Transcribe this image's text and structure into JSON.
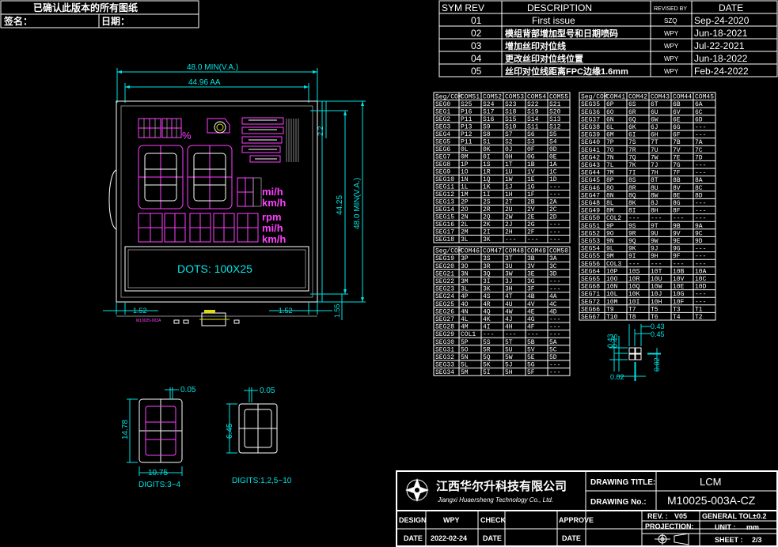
{
  "signoff": {
    "title": "已确认此版本的所有图纸",
    "sign_label": "签名：",
    "date_label": "日期："
  },
  "revisions": {
    "headers": [
      "SYM REV",
      "DESCRIPTION",
      "REVISED BY",
      "DATE"
    ],
    "rows": [
      {
        "rev": "01",
        "desc": "First issue",
        "by": "SZQ",
        "date": "Sep-24-2020"
      },
      {
        "rev": "02",
        "desc": "模组背部增加型号和日期喷码",
        "by": "WPY",
        "date": "Jun-18-2021"
      },
      {
        "rev": "03",
        "desc": "增加丝印对位线",
        "by": "WPY",
        "date": "Jul-22-2021"
      },
      {
        "rev": "04",
        "desc": "更改丝印对位线位置",
        "by": "WPY",
        "date": "Jun-18-2022"
      },
      {
        "rev": "05",
        "desc": "丝印对位线距离FPC边缘1.6mm",
        "by": "WPY",
        "date": "Feb-24-2022"
      }
    ]
  },
  "dimensions": {
    "width_va": "48.0 MIN(V.A.)",
    "width_aa": "44.96 AA",
    "height_aa": "44.25",
    "height_va": "48.0 MIN(V.A.)",
    "top_gap": "2.2",
    "left_margin": "1.52",
    "right_margin": "1.52",
    "bottom_margin": "1.55"
  },
  "display": {
    "dots_label": "DOTS: 100X25",
    "unit_mih_1": "mi/h",
    "unit_kmh_1": "km/h",
    "unit_rpm": "rpm",
    "unit_mih_2": "mi/h",
    "unit_kmh_2": "km/h",
    "percent": "%",
    "part_marking": "M10025-003A"
  },
  "pin_tables": {
    "table1": {
      "headers": [
        "Seg/COM",
        "COM51",
        "COM52",
        "COM53",
        "COM54",
        "COM55"
      ],
      "rows": [
        [
          "SEG0",
          "S25",
          "S24",
          "S23",
          "S22",
          "S21"
        ],
        [
          "SEG1",
          "P16",
          "S17",
          "S18",
          "S19",
          "S20"
        ],
        [
          "SEG2",
          "P11",
          "S16",
          "S15",
          "S14",
          "S13"
        ],
        [
          "SEG3",
          "P13",
          "S9",
          "S10",
          "S11",
          "S12"
        ],
        [
          "SEG4",
          "P12",
          "S8",
          "S7",
          "S6",
          "S5"
        ],
        [
          "SEG5",
          "P11",
          "S1",
          "S2",
          "S3",
          "S4"
        ],
        [
          "SEG6",
          "0L",
          "0K",
          "0J",
          "0F",
          "0D"
        ],
        [
          "SEG7",
          "0M",
          "0I",
          "0H",
          "0G",
          "0E"
        ],
        [
          "SEG8",
          "1P",
          "1S",
          "1T",
          "1B",
          "1A"
        ],
        [
          "SEG9",
          "1O",
          "1R",
          "1U",
          "1V",
          "1C"
        ],
        [
          "SEG10",
          "1N",
          "1Q",
          "1W",
          "1E",
          "1D"
        ],
        [
          "SEG11",
          "1L",
          "1K",
          "1J",
          "1G",
          "---"
        ],
        [
          "SEG12",
          "1M",
          "1I",
          "1H",
          "1F",
          "---"
        ],
        [
          "SEG13",
          "2P",
          "2S",
          "2T",
          "2B",
          "2A"
        ],
        [
          "SEG14",
          "2O",
          "2R",
          "2U",
          "2V",
          "2C"
        ],
        [
          "SEG15",
          "2N",
          "2Q",
          "2W",
          "2E",
          "2D"
        ],
        [
          "SEG16",
          "2L",
          "2K",
          "2J",
          "2G",
          "---"
        ],
        [
          "SEG17",
          "2M",
          "2I",
          "2H",
          "2F",
          "---"
        ],
        [
          "SEG18",
          "3L",
          "3K",
          "---",
          "---",
          "---"
        ]
      ]
    },
    "table2": {
      "headers": [
        "Seg/COM",
        "COM41",
        "COM42",
        "COM43",
        "COM44",
        "COM45"
      ],
      "rows": [
        [
          "SEG35",
          "6P",
          "6S",
          "6T",
          "6B",
          "6A"
        ],
        [
          "SEG36",
          "6O",
          "6R",
          "6U",
          "6V",
          "6C"
        ],
        [
          "SEG37",
          "6N",
          "6Q",
          "6W",
          "6E",
          "6D"
        ],
        [
          "SEG38",
          "6L",
          "6K",
          "6J",
          "6G",
          "---"
        ],
        [
          "SEG39",
          "6M",
          "6I",
          "6H",
          "6F",
          "---"
        ],
        [
          "SEG40",
          "7P",
          "7S",
          "7T",
          "7B",
          "7A"
        ],
        [
          "SEG41",
          "7O",
          "7R",
          "7U",
          "7V",
          "7C"
        ],
        [
          "SEG42",
          "7N",
          "7Q",
          "7W",
          "7E",
          "7D"
        ],
        [
          "SEG43",
          "7L",
          "7K",
          "7J",
          "7G",
          "---"
        ],
        [
          "SEG44",
          "7M",
          "7I",
          "7H",
          "7F",
          "---"
        ],
        [
          "SEG45",
          "8P",
          "8S",
          "8T",
          "8B",
          "8A"
        ],
        [
          "SEG46",
          "8O",
          "8R",
          "8U",
          "8V",
          "8C"
        ],
        [
          "SEG47",
          "8N",
          "8Q",
          "8W",
          "8E",
          "8D"
        ],
        [
          "SEG48",
          "8L",
          "8K",
          "8J",
          "8G",
          "---"
        ],
        [
          "SEG49",
          "8M",
          "8I",
          "8H",
          "8F",
          "---"
        ],
        [
          "SEG50",
          "COL2",
          "---",
          "---",
          "---",
          "---"
        ],
        [
          "SEG51",
          "9P",
          "9S",
          "9T",
          "9B",
          "9A"
        ],
        [
          "SEG52",
          "9O",
          "9R",
          "9U",
          "9V",
          "9C"
        ],
        [
          "SEG53",
          "9N",
          "9Q",
          "9W",
          "9E",
          "9D"
        ],
        [
          "SEG54",
          "9L",
          "9K",
          "9J",
          "9G",
          "---"
        ],
        [
          "SEG55",
          "9M",
          "9I",
          "9H",
          "9F",
          "---"
        ],
        [
          "SEG56",
          "COL3",
          "---",
          "---",
          "---",
          "---"
        ],
        [
          "SEG64",
          "10P",
          "10S",
          "10T",
          "10B",
          "10A"
        ],
        [
          "SEG65",
          "10O",
          "10R",
          "10U",
          "10V",
          "10C"
        ],
        [
          "SEG68",
          "10N",
          "10Q",
          "10W",
          "10E",
          "10D"
        ],
        [
          "SEG71",
          "10L",
          "10K",
          "10J",
          "10G",
          "---"
        ],
        [
          "SEG72",
          "10M",
          "10I",
          "10H",
          "10F",
          "---"
        ],
        [
          "SEG66",
          "T9",
          "T7",
          "T5",
          "T3",
          "T1"
        ],
        [
          "SEG67",
          "T10",
          "T8",
          "T6",
          "T4",
          "T2"
        ]
      ]
    },
    "table3": {
      "headers": [
        "Seg/COM",
        "COM46",
        "COM47",
        "COM48",
        "COM49",
        "COM50"
      ],
      "rows": [
        [
          "SEG19",
          "3P",
          "3S",
          "3T",
          "3B",
          "3A"
        ],
        [
          "SEG20",
          "3O",
          "3R",
          "3U",
          "3V",
          "3C"
        ],
        [
          "SEG21",
          "3N",
          "3Q",
          "3W",
          "3E",
          "3D"
        ],
        [
          "SEG22",
          "3M",
          "3I",
          "3J",
          "3G",
          "---"
        ],
        [
          "SEG23",
          "3L",
          "3K",
          "3H",
          "3F",
          "---"
        ],
        [
          "SEG24",
          "4P",
          "4S",
          "4T",
          "4B",
          "4A"
        ],
        [
          "SEG25",
          "4O",
          "4R",
          "4U",
          "4V",
          "4C"
        ],
        [
          "SEG26",
          "4N",
          "4Q",
          "4W",
          "4E",
          "4D"
        ],
        [
          "SEG27",
          "4L",
          "4K",
          "4J",
          "4G",
          "---"
        ],
        [
          "SEG28",
          "4M",
          "4I",
          "4H",
          "4F",
          "---"
        ],
        [
          "SEG29",
          "COL1",
          "---",
          "---",
          "---",
          "---"
        ],
        [
          "SEG30",
          "5P",
          "5S",
          "5T",
          "5B",
          "5A"
        ],
        [
          "SEG31",
          "5O",
          "5R",
          "5U",
          "5V",
          "5C"
        ],
        [
          "SEG32",
          "5N",
          "5Q",
          "5W",
          "5E",
          "5D"
        ],
        [
          "SEG33",
          "5L",
          "5K",
          "5J",
          "5G",
          "---"
        ],
        [
          "SEG34",
          "5M",
          "5I",
          "5H",
          "5F",
          "---"
        ]
      ]
    }
  },
  "dot_detail": {
    "pitch_1": "0.43",
    "pitch_2": "0.45",
    "v_1": "0.43",
    "v_2": "0.45",
    "gap_h": "0.02",
    "gap_v": "0.02"
  },
  "digit_details": {
    "large": {
      "height": "14.78",
      "width": "10.75",
      "gap": "0.05",
      "caption": "DIGITS:3~4"
    },
    "small": {
      "height": "6.45",
      "gap": "0.05",
      "caption": "DIGITS:1,2,5~10"
    }
  },
  "title_block": {
    "company_cn": "江西华尔升科技有限公司",
    "company_en": "Jiangxi Huaersheng Technology Co., Ltd.",
    "drawing_title_label": "DRAWING TITLE:",
    "drawing_title": "LCM",
    "drawing_no_label": "DRAWING No.:",
    "drawing_no": "M10025-003A-CZ",
    "rev_label": "REV. :",
    "rev": "V05",
    "tol_label": "GENERAL TOL:",
    "tol": "±0.2",
    "projection_label": "PROJECTION:",
    "unit_label": "UNIT :",
    "unit": "mm",
    "sheet_label": "SHEET :",
    "sheet": "2/3",
    "design_label": "DESIGN",
    "design": "WPY",
    "check_label": "CHECK",
    "approve_label": "APPROVE",
    "date_label": "DATE",
    "date": "2022-02-24",
    "date_label_2": "DATE",
    "date_label_3": "DATE"
  },
  "colors": {
    "background": "#000000",
    "line": "#ffffff",
    "dimension": "#00e5e5",
    "segment": "#ff40ff",
    "accent": "#e0e000"
  }
}
